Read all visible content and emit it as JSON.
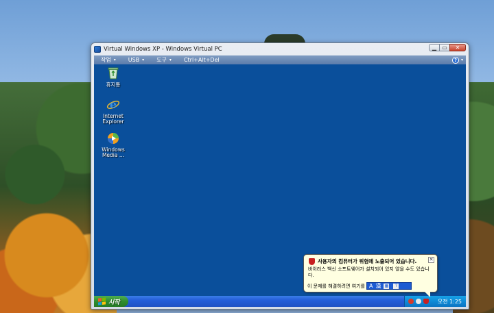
{
  "window": {
    "title": "Virtual Windows XP - Windows Virtual PC",
    "controls": {
      "minimize": "▁",
      "maximize": "▭",
      "close": "✕"
    }
  },
  "menubar": {
    "items": [
      {
        "label": "작업",
        "caret": "▾"
      },
      {
        "label": "USB",
        "caret": "▾"
      },
      {
        "label": "도구",
        "caret": "▾"
      },
      {
        "label": "Ctrl+Alt+Del"
      }
    ],
    "help_label": "?",
    "help_caret": "▾"
  },
  "desktop": {
    "icons": [
      {
        "label": "휴지통",
        "icon": "recycle-bin-icon"
      },
      {
        "label": "Internet\nExplorer",
        "icon": "internet-explorer-icon"
      },
      {
        "label": "Windows\nMedia ...",
        "icon": "media-player-icon"
      }
    ],
    "background_color": "#0a4f9b"
  },
  "taskbar": {
    "start_label": "시작",
    "clock": "오전 1:25"
  },
  "balloon": {
    "title": "사용자의 컴퓨터가 위험에 노출되어 있습니다.",
    "body": "바이러스 백신 소프트웨어가 설치되어 있지 않을 수도 있습니다.",
    "footer": "이 문제를 해결하려면 여기를",
    "close": "✕",
    "ime": {
      "mode": "A",
      "hanja": "漢",
      "help": "?"
    }
  },
  "colors": {
    "xp_blue": "#0a4f9b",
    "start_green": "#2f8d2f",
    "tray_blue": "#0f8ad6",
    "balloon_bg": "#ffffe1",
    "menubar": "#6a88b5"
  }
}
